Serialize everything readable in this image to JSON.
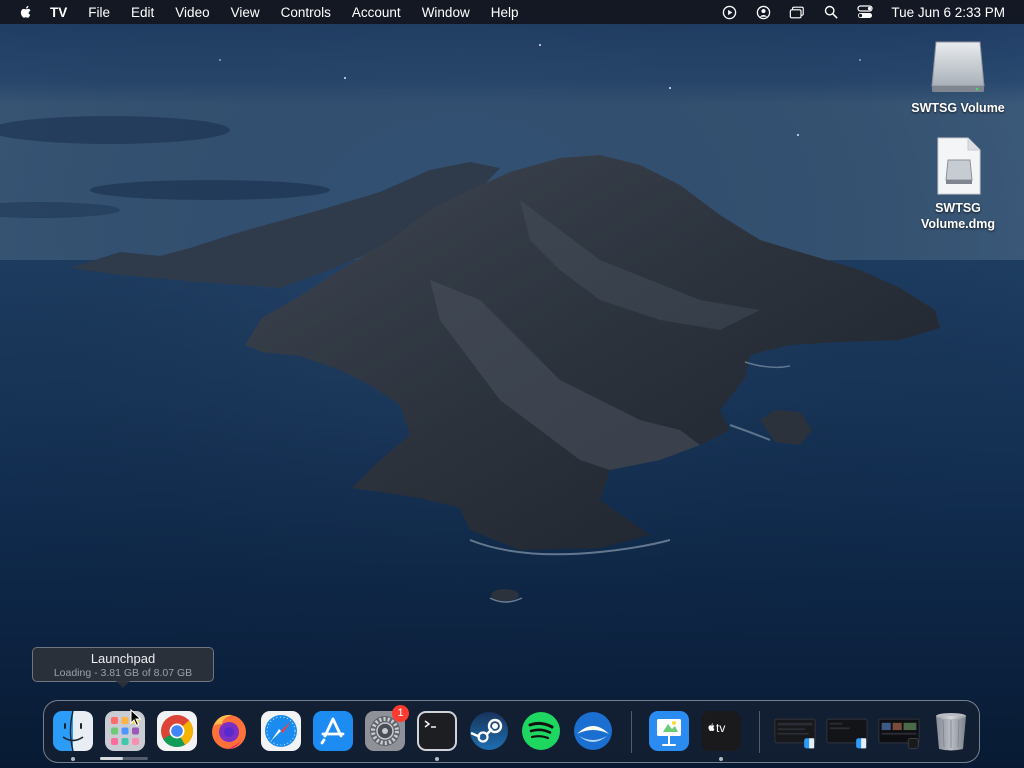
{
  "menubar": {
    "app_name": "TV",
    "items": [
      "File",
      "Edit",
      "Video",
      "View",
      "Controls",
      "Account",
      "Window",
      "Help"
    ],
    "status_icons": [
      "play-circle-icon",
      "user-circle-icon",
      "window-stack-icon",
      "search-icon",
      "control-center-icon"
    ],
    "clock": "Tue Jun 6  2:33 PM"
  },
  "desktop": {
    "icons": [
      {
        "label": "SWTSG Volume",
        "icon": "disk-drive-icon"
      },
      {
        "label": "SWTSG Volume.dmg",
        "icon": "dmg-file-icon"
      }
    ]
  },
  "tooltip": {
    "title": "Launchpad",
    "subtitle": "Loading - 3.81 GB of 8.07 GB",
    "progress": 0.47
  },
  "dock": {
    "apps": [
      {
        "name": "Finder",
        "icon": "finder-icon",
        "running": true
      },
      {
        "name": "Launchpad",
        "icon": "launchpad-icon",
        "running": false
      },
      {
        "name": "Google Chrome",
        "icon": "chrome-icon",
        "running": false
      },
      {
        "name": "Firefox",
        "icon": "firefox-icon",
        "running": false
      },
      {
        "name": "Safari",
        "icon": "safari-icon",
        "running": false
      },
      {
        "name": "App Store",
        "icon": "app-store-icon",
        "running": false
      },
      {
        "name": "System Settings",
        "icon": "settings-gear-icon",
        "running": false,
        "badge": "1"
      },
      {
        "name": "Terminal",
        "icon": "terminal-icon",
        "running": true
      },
      {
        "name": "Steam",
        "icon": "steam-icon",
        "running": false
      },
      {
        "name": "Spotify",
        "icon": "spotify-icon",
        "running": false
      },
      {
        "name": "Thunderbird",
        "icon": "thunderbird-icon",
        "running": false
      },
      {
        "name": "Keynote",
        "icon": "keynote-icon",
        "running": false
      },
      {
        "name": "TV",
        "icon": "apple-tv-icon",
        "running": true,
        "label": "tv"
      }
    ]
  },
  "colors": {
    "menubar_bg": "#12161e",
    "sky_top": "#1d3a63",
    "sea": "#0f2a4d",
    "badge": "#ff3b30"
  }
}
